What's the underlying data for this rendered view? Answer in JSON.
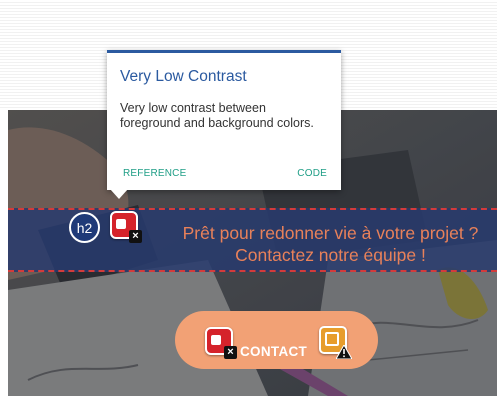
{
  "tooltip": {
    "title": "Very Low Contrast",
    "body": "Very low contrast between foreground and background colors.",
    "reference_label": "REFERENCE",
    "code_label": "CODE",
    "accent_color": "#2b5aa0",
    "link_color": "#1f9e86"
  },
  "heading_badge": {
    "label": "h2"
  },
  "banner": {
    "line1": "Prêt pour redonner vie à votre projet ?",
    "line2": "Contactez notre équipe !",
    "text_color": "#e8815a",
    "background_color": "#283a6e"
  },
  "contact_button": {
    "label": "CONTACT",
    "background_color": "#f2a175"
  },
  "issue_icons": {
    "contrast_error": "contrast-error-icon",
    "alert_warning": "alert-warning-icon"
  }
}
